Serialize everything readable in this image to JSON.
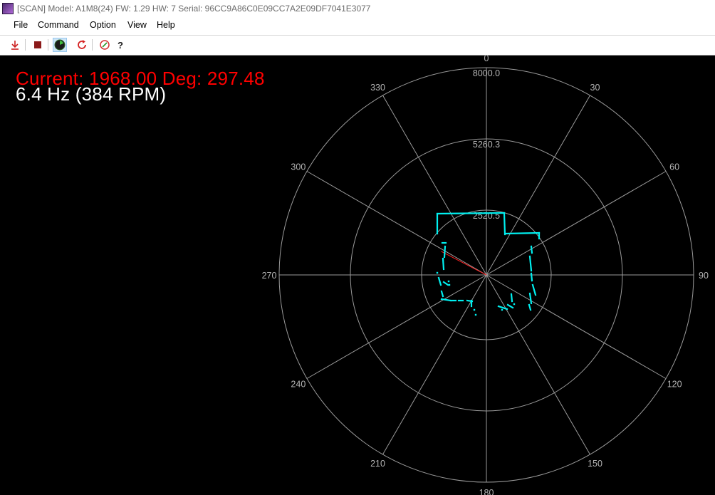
{
  "window": {
    "title": "[SCAN] Model: A1M8(24) FW: 1.29 HW: 7 Serial: 96CC9A86C0E09CC7A2E09DF7041E3077"
  },
  "menu": {
    "file": "File",
    "command": "Command",
    "option": "Option",
    "view": "View",
    "help": "Help"
  },
  "toolbar": {
    "help_label": "?",
    "icons": [
      "download-icon",
      "stop-icon",
      "radar-icon",
      "refresh-icon",
      "compass-icon",
      "help-icon"
    ]
  },
  "overlay": {
    "current_text": "Current: 1968.00 Deg: 297.48",
    "frequency_text": "6.4 Hz (384 RPM)"
  },
  "plot": {
    "ring_labels": [
      "8000.0",
      "5260.3",
      "2520.5"
    ],
    "angle_labels": [
      "0",
      "30",
      "60",
      "90",
      "120",
      "150",
      "180",
      "210",
      "240",
      "270",
      "300",
      "330"
    ],
    "colors": {
      "background": "#000000",
      "grid": "#9a9a9a",
      "scan": "#00f0f0",
      "current_ray": "#ff2020",
      "current_text": "#ff0000"
    },
    "current_angle_deg": 297.48,
    "current_distance": 1968.0
  }
}
